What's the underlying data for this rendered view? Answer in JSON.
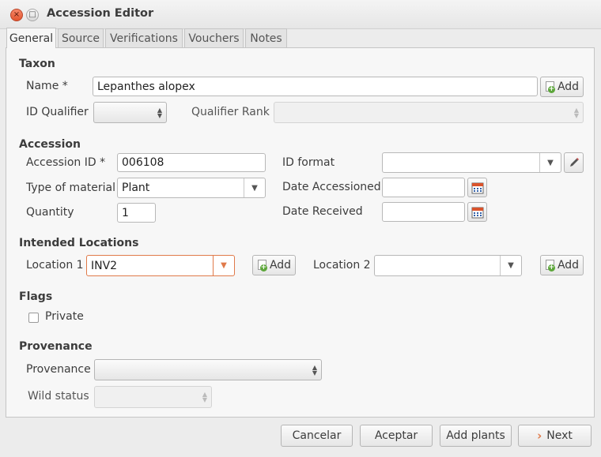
{
  "window": {
    "title": "Accession Editor"
  },
  "tabs": [
    "General",
    "Source",
    "Verifications",
    "Vouchers",
    "Notes"
  ],
  "taxon": {
    "section": "Taxon",
    "name_label": "Name *",
    "name_value": "Lepanthes alopex",
    "add_label": "Add",
    "id_qualifier_label": "ID Qualifier",
    "qualifier_rank_label": "Qualifier Rank"
  },
  "accession": {
    "section": "Accession",
    "accession_id_label": "Accession ID *",
    "accession_id_value": "006108",
    "id_format_label": "ID format",
    "type_label": "Type of material",
    "type_value": "Plant",
    "date_accessioned_label": "Date Accessioned",
    "quantity_label": "Quantity",
    "quantity_value": "1",
    "date_received_label": "Date Received"
  },
  "locations": {
    "section": "Intended Locations",
    "location1_label": "Location 1",
    "location1_value": "INV2",
    "add_label": "Add",
    "location2_label": "Location 2"
  },
  "flags": {
    "section": "Flags",
    "private_label": "Private",
    "private_checked": false
  },
  "provenance": {
    "section": "Provenance",
    "provenance_label": "Provenance",
    "wild_status_label": "Wild status"
  },
  "footer": {
    "cancel": "Cancelar",
    "accept": "Aceptar",
    "add_plants": "Add plants",
    "next": "Next"
  },
  "colors": {
    "focus": "#e07a4a",
    "add_green": "#5ca63a",
    "close_red": "#e2542e"
  }
}
